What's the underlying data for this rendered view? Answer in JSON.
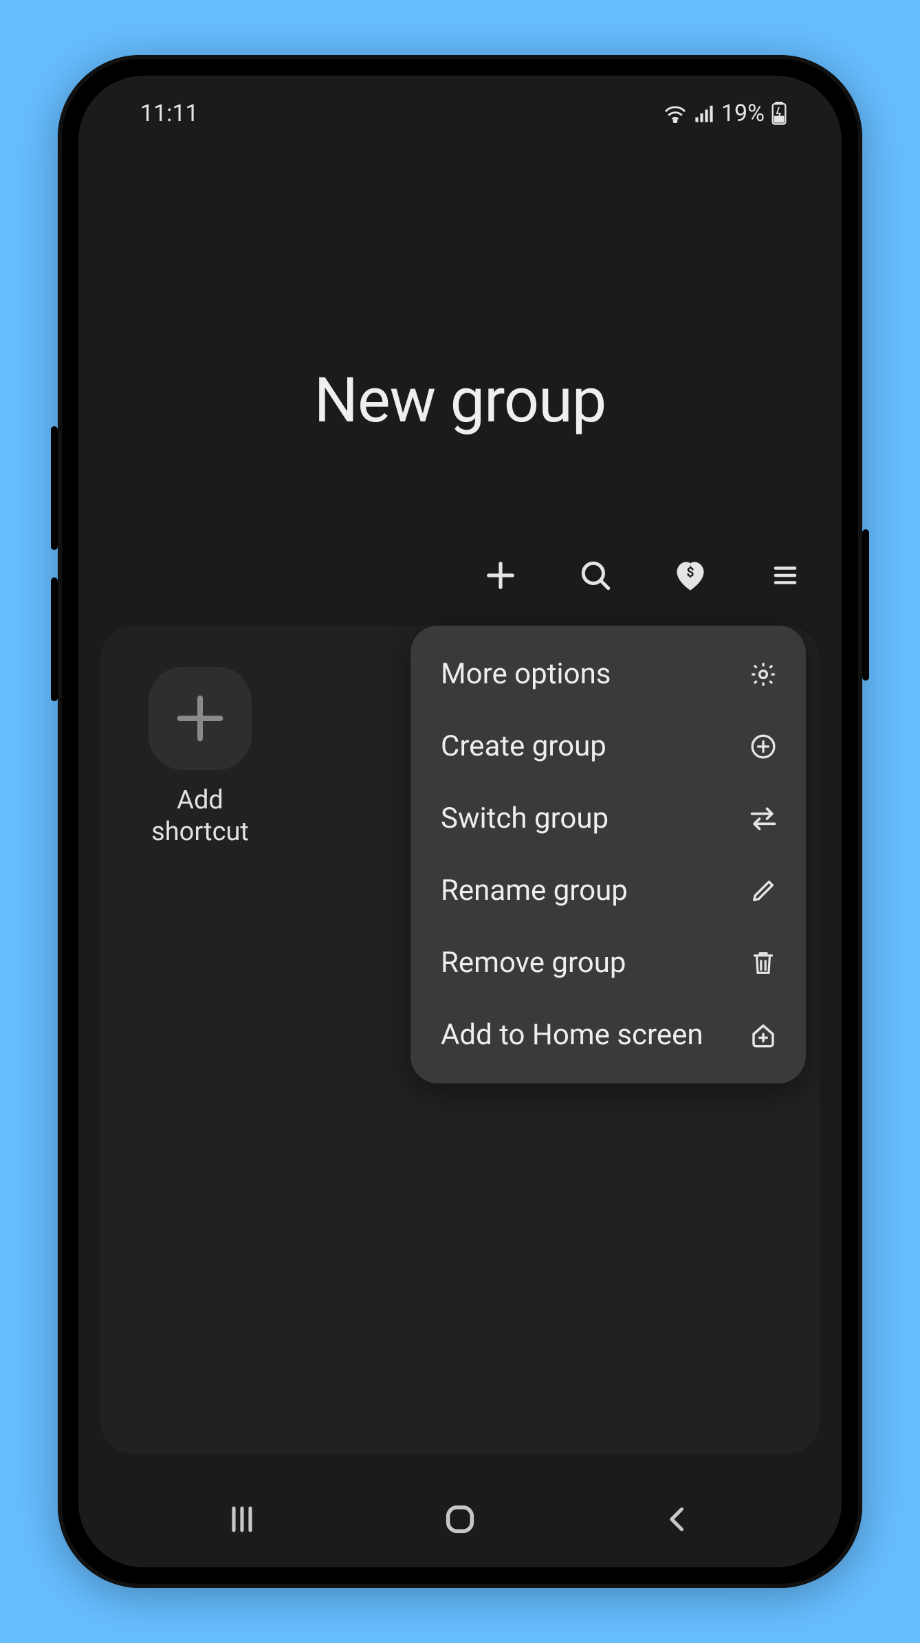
{
  "status": {
    "time": "11:11",
    "battery_text": "19%"
  },
  "title": "New group",
  "shortcut": {
    "label": "Add\nshortcut"
  },
  "menu": {
    "items": [
      {
        "label": "More options"
      },
      {
        "label": "Create group"
      },
      {
        "label": "Switch group"
      },
      {
        "label": "Rename group"
      },
      {
        "label": "Remove group"
      },
      {
        "label": "Add to Home screen"
      }
    ]
  }
}
